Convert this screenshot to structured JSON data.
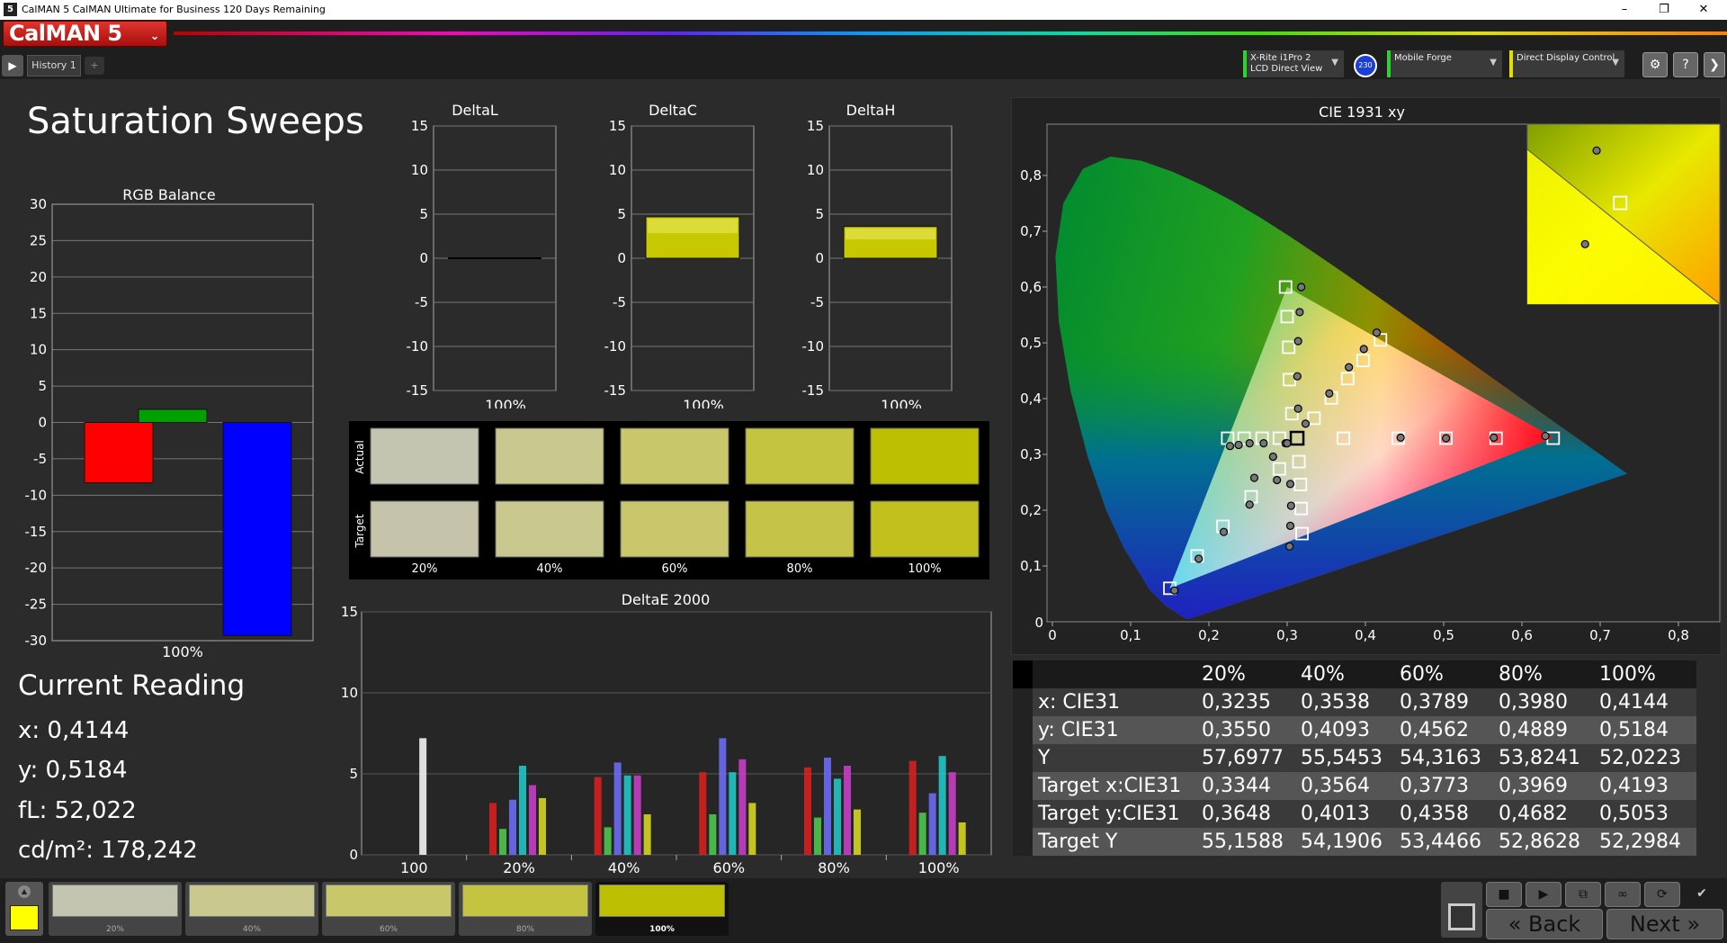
{
  "window": {
    "title": "CalMAN 5 CalMAN Ultimate for Business 120 Days Remaining",
    "app_icon_text": "5",
    "minimize": "–",
    "restore": "❐",
    "close": "✕"
  },
  "logo": {
    "text": "CalMAN 5",
    "chevron": "⌄"
  },
  "tabs": {
    "play": "▶",
    "history": "History 1",
    "add": "+"
  },
  "devices": [
    {
      "line1": "X-Rite i1Pro 2",
      "line2": "LCD Direct View",
      "accent": "#30d030"
    },
    {
      "line1": "Mobile Forge",
      "line2": "",
      "accent": "#30d030"
    },
    {
      "line1": "Direct Display Control",
      "line2": "",
      "accent": "#e0e000"
    }
  ],
  "badge": "230",
  "toolbar_icons": {
    "gear": "⚙",
    "help": "?",
    "collapse": "❯"
  },
  "page_title": "Saturation Sweeps",
  "rgb_balance": {
    "title": "RGB Balance",
    "ylim": [
      -30,
      30
    ],
    "yticks": [
      "30",
      "25",
      "20",
      "15",
      "10",
      "5",
      "0",
      "-5",
      "-10",
      "-15",
      "-20",
      "-25",
      "-30"
    ],
    "xlabel": "100%",
    "values": {
      "red": -8.3,
      "green": 1.8,
      "blue": -29.3
    },
    "colors": {
      "red": "#ff0000",
      "green": "#00a000",
      "blue": "#0000ff"
    }
  },
  "delta_charts": [
    {
      "title": "DeltaL",
      "value": 0.0,
      "xlabel": "100%"
    },
    {
      "title": "DeltaC",
      "value": 4.7,
      "xlabel": "100%"
    },
    {
      "title": "DeltaH",
      "value": 3.6,
      "xlabel": "100%"
    }
  ],
  "delta_yticks": [
    "15",
    "10",
    "5",
    "0",
    "-5",
    "-10",
    "-15"
  ],
  "swatches": {
    "actual_label": "Actual",
    "target_label": "Target",
    "items": [
      {
        "label": "20%",
        "actual": "#c4c5b0",
        "target": "#c5c4ab"
      },
      {
        "label": "40%",
        "actual": "#c9c98f",
        "target": "#c9c88f"
      },
      {
        "label": "60%",
        "actual": "#c8c86a",
        "target": "#c9c66b"
      },
      {
        "label": "80%",
        "actual": "#c4c441",
        "target": "#c6c448"
      },
      {
        "label": "100%",
        "actual": "#bdbf03",
        "target": "#c1c01c"
      }
    ]
  },
  "deltae": {
    "title": "DeltaE 2000",
    "yticks": [
      "15",
      "10",
      "5",
      "0"
    ],
    "ylim": [
      0,
      15
    ],
    "groups": [
      "100",
      "20%",
      "40%",
      "60%",
      "80%",
      "100%"
    ],
    "series_colors": [
      "#e02020",
      "#50d050",
      "#7070ff",
      "#20d0d0",
      "#d040d0",
      "#e0e020",
      "#ffffff"
    ],
    "values": [
      [
        0,
        0,
        0,
        0,
        0,
        0,
        7.2
      ],
      [
        3.2,
        1.6,
        3.4,
        5.5,
        4.3,
        3.5,
        0
      ],
      [
        4.8,
        1.7,
        5.7,
        4.9,
        4.9,
        2.5,
        0
      ],
      [
        5.1,
        2.5,
        7.2,
        5.1,
        5.9,
        3.2,
        0
      ],
      [
        5.4,
        2.3,
        6.0,
        4.7,
        5.5,
        2.8,
        0
      ],
      [
        5.8,
        2.6,
        3.8,
        6.1,
        5.1,
        2.0,
        0
      ]
    ]
  },
  "cie": {
    "title": "CIE 1931 xy",
    "xticks": [
      "0",
      "0,1",
      "0,2",
      "0,3",
      "0,4",
      "0,5",
      "0,6",
      "0,7",
      "0,8"
    ],
    "yticks": [
      "0,1",
      "0,2",
      "0,3",
      "0,4",
      "0,5",
      "0,6",
      "0,7",
      "0,8"
    ],
    "y_zero": "0",
    "gamut": [
      [
        0.64,
        0.33
      ],
      [
        0.3,
        0.6
      ],
      [
        0.15,
        0.06
      ]
    ],
    "targets": [
      [
        0.3127,
        0.329
      ],
      [
        0.3344,
        0.3648
      ],
      [
        0.3564,
        0.4013
      ],
      [
        0.3773,
        0.4358
      ],
      [
        0.3969,
        0.4682
      ],
      [
        0.4193,
        0.5053
      ],
      [
        0.224,
        0.329
      ],
      [
        0.245,
        0.329
      ],
      [
        0.268,
        0.329
      ],
      [
        0.29,
        0.329
      ],
      [
        0.372,
        0.329
      ],
      [
        0.442,
        0.329
      ],
      [
        0.503,
        0.329
      ],
      [
        0.567,
        0.329
      ],
      [
        0.64,
        0.329
      ],
      [
        0.29,
        0.274
      ],
      [
        0.254,
        0.224
      ],
      [
        0.218,
        0.171
      ],
      [
        0.185,
        0.118
      ],
      [
        0.15,
        0.06
      ],
      [
        0.315,
        0.287
      ],
      [
        0.317,
        0.246
      ],
      [
        0.318,
        0.203
      ],
      [
        0.319,
        0.158
      ],
      [
        0.306,
        0.373
      ],
      [
        0.303,
        0.434
      ],
      [
        0.302,
        0.492
      ],
      [
        0.3,
        0.547
      ],
      [
        0.298,
        0.6
      ]
    ],
    "actual": [
      [
        0.3235,
        0.355
      ],
      [
        0.3538,
        0.4093
      ],
      [
        0.3789,
        0.4562
      ],
      [
        0.398,
        0.4889
      ],
      [
        0.4144,
        0.5184
      ],
      [
        0.227,
        0.315
      ],
      [
        0.238,
        0.317
      ],
      [
        0.252,
        0.32
      ],
      [
        0.27,
        0.32
      ],
      [
        0.298,
        0.32
      ],
      [
        0.445,
        0.33
      ],
      [
        0.503,
        0.329
      ],
      [
        0.564,
        0.33
      ],
      [
        0.63,
        0.333
      ],
      [
        0.287,
        0.254
      ],
      [
        0.252,
        0.21
      ],
      [
        0.219,
        0.161
      ],
      [
        0.187,
        0.113
      ],
      [
        0.156,
        0.056
      ],
      [
        0.304,
        0.247
      ],
      [
        0.305,
        0.208
      ],
      [
        0.304,
        0.172
      ],
      [
        0.303,
        0.135
      ],
      [
        0.314,
        0.382
      ],
      [
        0.313,
        0.44
      ],
      [
        0.314,
        0.503
      ],
      [
        0.316,
        0.555
      ],
      [
        0.318,
        0.6
      ],
      [
        0.3,
        0.32
      ],
      [
        0.282,
        0.296
      ],
      [
        0.258,
        0.258
      ]
    ],
    "inset": {
      "targets": [
        [
          0.4193,
          0.5053
        ]
      ],
      "actual": [
        [
          0.4144,
          0.5184
        ],
        [
          0.412,
          0.495
        ]
      ]
    }
  },
  "current_reading": {
    "title": "Current Reading",
    "x": "x: 0,4144",
    "y": "y: 0,5184",
    "fl": "fL: 52,022",
    "cdm2": "cd/m²: 178,242"
  },
  "table": {
    "headers": [
      "20%",
      "40%",
      "60%",
      "80%",
      "100%"
    ],
    "rows": [
      {
        "label": "x: CIE31",
        "values": [
          "0,3235",
          "0,3538",
          "0,3789",
          "0,3980",
          "0,4144"
        ]
      },
      {
        "label": "y: CIE31",
        "values": [
          "0,3550",
          "0,4093",
          "0,4562",
          "0,4889",
          "0,5184"
        ]
      },
      {
        "label": "Y",
        "values": [
          "57,6977",
          "55,5453",
          "54,3163",
          "53,8241",
          "52,0223"
        ]
      },
      {
        "label": "Target x:CIE31",
        "values": [
          "0,3344",
          "0,3564",
          "0,3773",
          "0,3969",
          "0,4193"
        ]
      },
      {
        "label": "Target y:CIE31",
        "values": [
          "0,3648",
          "0,4013",
          "0,4358",
          "0,4682",
          "0,5053"
        ]
      },
      {
        "label": "Target Y",
        "values": [
          "55,1588",
          "54,1906",
          "53,4466",
          "52,8628",
          "52,2984"
        ]
      }
    ]
  },
  "bottom": {
    "current_color": "#ffff00",
    "swatches": [
      {
        "label": "20%",
        "color": "#c4c5b0"
      },
      {
        "label": "40%",
        "color": "#c9c98f"
      },
      {
        "label": "60%",
        "color": "#c8c86a"
      },
      {
        "label": "80%",
        "color": "#c4c441"
      },
      {
        "label": "100%",
        "color": "#bdbf03"
      }
    ],
    "controls": [
      "■",
      "▶",
      "⧉",
      "∞",
      "⟳",
      "✔"
    ],
    "back": "Back",
    "next": "Next",
    "back_icon": "«",
    "next_icon": "»"
  }
}
